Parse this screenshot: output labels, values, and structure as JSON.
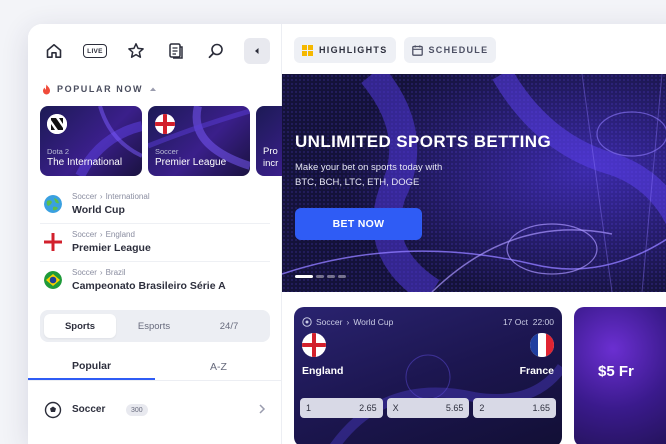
{
  "sidebar": {
    "icons": [
      "home-icon",
      "live-icon",
      "star-icon",
      "betslip-icon",
      "search-icon",
      "collapse-left-icon"
    ],
    "live_label": "LIVE",
    "popular_title": "POPULAR NOW",
    "cards": [
      {
        "sub": "Dota 2",
        "title": "The International",
        "badge": "dota-logo-icon"
      },
      {
        "sub": "Soccer",
        "title": "Premier League",
        "badge": "england-flag-icon"
      },
      {
        "sub": "Pro",
        "title": "incr",
        "badge": ""
      }
    ],
    "leagues": [
      {
        "sport": "Soccer",
        "region": "International",
        "name": "World Cup",
        "flag": "globe-icon"
      },
      {
        "sport": "Soccer",
        "region": "England",
        "name": "Premier League",
        "flag": "england-flag-icon"
      },
      {
        "sport": "Soccer",
        "region": "Brazil",
        "name": "Campeonato Brasileiro Série A",
        "flag": "brazil-flag-icon"
      }
    ],
    "sport_tabs": [
      "Sports",
      "Esports",
      "24/7"
    ],
    "list_tabs": [
      "Popular",
      "A-Z"
    ],
    "bottom_item": {
      "name": "Soccer",
      "count": "300"
    }
  },
  "main": {
    "tabs": [
      {
        "label": "HIGHLIGHTS",
        "icon": "grid-icon"
      },
      {
        "label": "SCHEDULE",
        "icon": "calendar-icon"
      }
    ],
    "banner": {
      "headline": "UNLIMITED SPORTS BETTING",
      "line1": "Make your bet on sports today with",
      "line2": "BTC, BCH, LTC, ETH, DOGE",
      "cta": "BET NOW",
      "slides": 4,
      "active_slide": 1
    },
    "match": {
      "sport": "Soccer",
      "league": "World Cup",
      "date": "17 Oct",
      "time": "22:00",
      "home": "England",
      "away": "France",
      "odds": [
        {
          "label": "1",
          "value": "2.65"
        },
        {
          "label": "X",
          "value": "5.65"
        },
        {
          "label": "2",
          "value": "1.65"
        }
      ]
    },
    "promo": {
      "text": "$5 Fr"
    }
  },
  "colors": {
    "accent": "#2f5cf5",
    "banner_bg": "#14123a",
    "highlight_icon": "#f5b800",
    "fire": "#f04b3a"
  }
}
